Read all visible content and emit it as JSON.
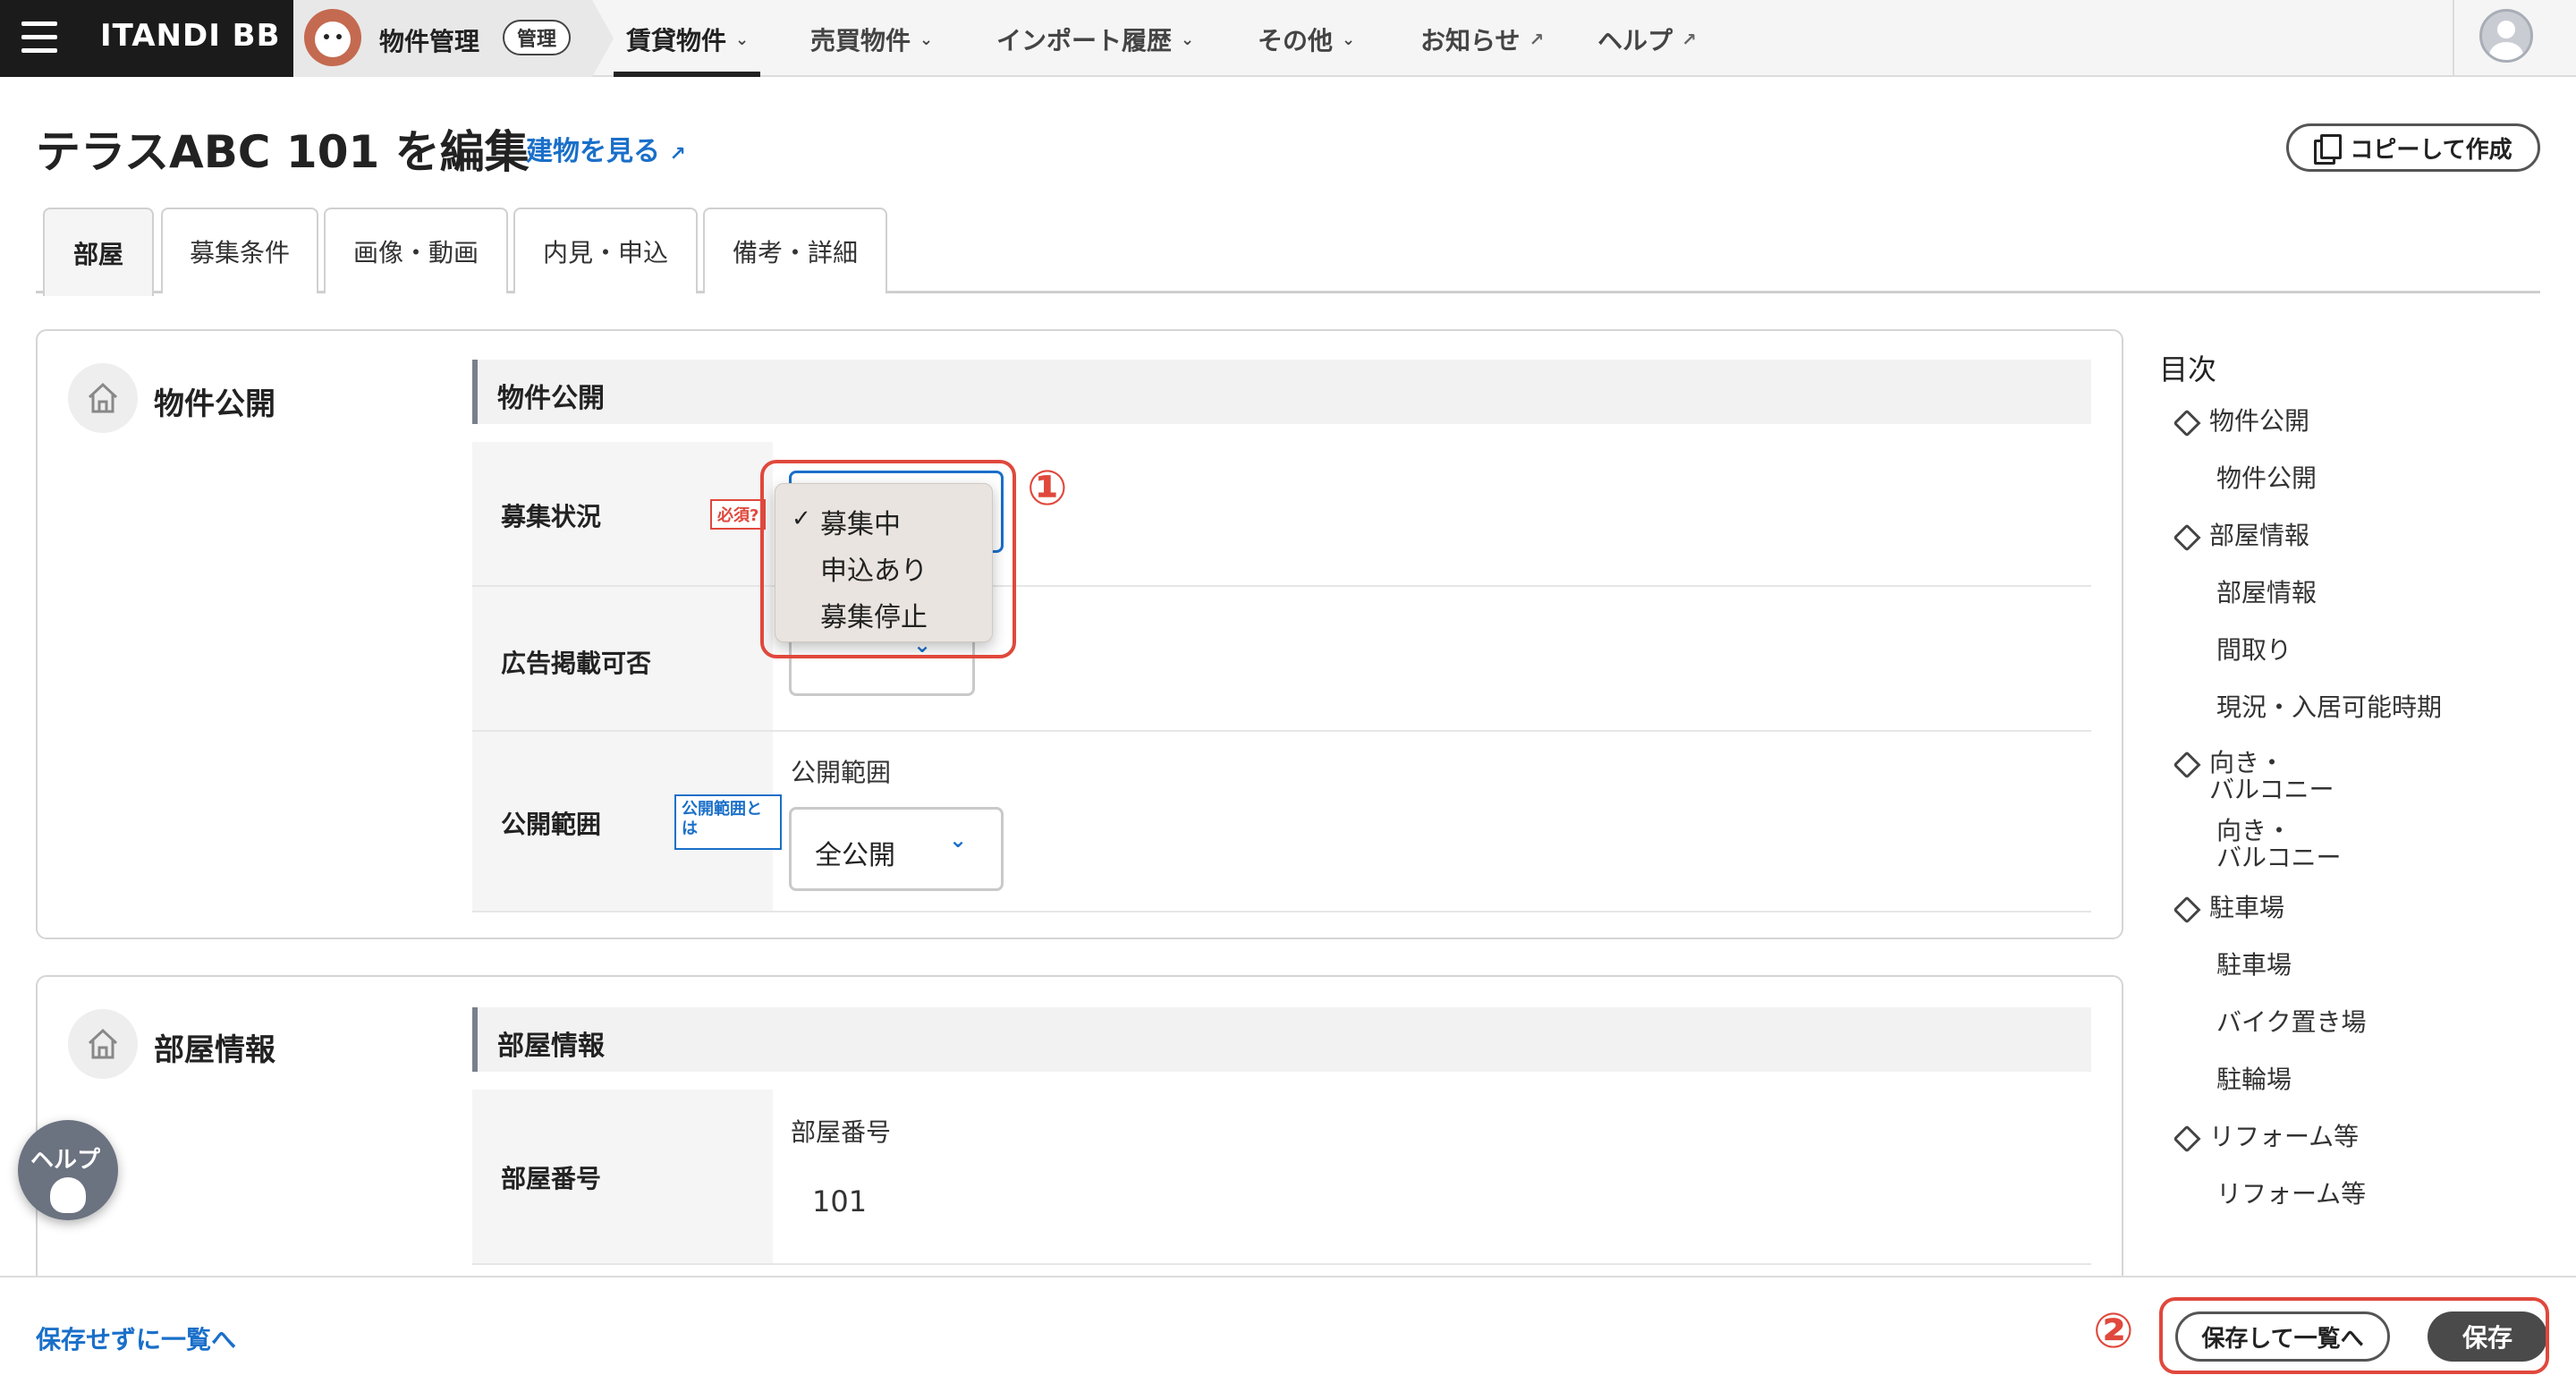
{
  "nav": {
    "brand": "ITANDI BB",
    "app_title": "物件管理",
    "app_badge": "管理",
    "items": [
      {
        "label": "賃貸物件",
        "icon": "chevron-down-icon"
      },
      {
        "label": "売買物件",
        "icon": "chevron-down-icon"
      },
      {
        "label": "インポート履歴",
        "icon": "chevron-down-icon"
      },
      {
        "label": "その他",
        "icon": "chevron-down-icon"
      },
      {
        "label": "お知らせ",
        "icon": "external-link-icon"
      },
      {
        "label": "ヘルプ",
        "icon": "external-link-icon"
      }
    ],
    "active_item": "賃貸物件"
  },
  "header": {
    "title": "テラスABC 101 を編集",
    "building_link": "建物を見る",
    "copy_button": "コピーして作成"
  },
  "tabs": [
    {
      "label": "部屋",
      "active": true
    },
    {
      "label": "募集条件",
      "active": false
    },
    {
      "label": "画像・動画",
      "active": false
    },
    {
      "label": "内見・申込",
      "active": false
    },
    {
      "label": "備考・詳細",
      "active": false
    }
  ],
  "section_publish": {
    "heading": "物件公開",
    "subheading": "物件公開",
    "recruit_status": {
      "label": "募集状況",
      "required_badge": "必須",
      "options": [
        "募集中",
        "申込あり",
        "募集停止"
      ],
      "selected": "募集中"
    },
    "ad_permission": {
      "label": "広告掲載可否"
    },
    "visibility": {
      "label": "公開範囲",
      "info_badge": "公開範囲とは",
      "caption": "公開範囲",
      "value": "全公開"
    }
  },
  "section_room": {
    "heading": "部屋情報",
    "subheading": "部屋情報",
    "room_number": {
      "label": "部屋番号",
      "caption": "部屋番号",
      "value": "101"
    }
  },
  "toc": {
    "title": "目次",
    "items": [
      {
        "label": "物件公開",
        "level": 1
      },
      {
        "label": "物件公開",
        "level": 2
      },
      {
        "label": "部屋情報",
        "level": 1
      },
      {
        "label": "部屋情報",
        "level": 2
      },
      {
        "label": "間取り",
        "level": 2
      },
      {
        "label": "現況・入居可能時期",
        "level": 2
      },
      {
        "label": "向き・\nバルコニー",
        "level": 1
      },
      {
        "label": "向き・\nバルコニー",
        "level": 2
      },
      {
        "label": "駐車場",
        "level": 1
      },
      {
        "label": "駐車場",
        "level": 2
      },
      {
        "label": "バイク置き場",
        "level": 2
      },
      {
        "label": "駐輪場",
        "level": 2
      },
      {
        "label": "リフォーム等",
        "level": 1
      },
      {
        "label": "リフォーム等",
        "level": 2
      }
    ]
  },
  "help_fab": "ヘルプ",
  "footer": {
    "back_link": "保存せずに一覧へ",
    "save_and_list": "保存して一覧へ",
    "save": "保存"
  },
  "annotations": {
    "marker_1": "①",
    "marker_2": "②",
    "color": "#e0483c"
  },
  "colors": {
    "accent": "#1a6fc9",
    "required": "#e0483c",
    "dark": "#1b1b1b"
  }
}
